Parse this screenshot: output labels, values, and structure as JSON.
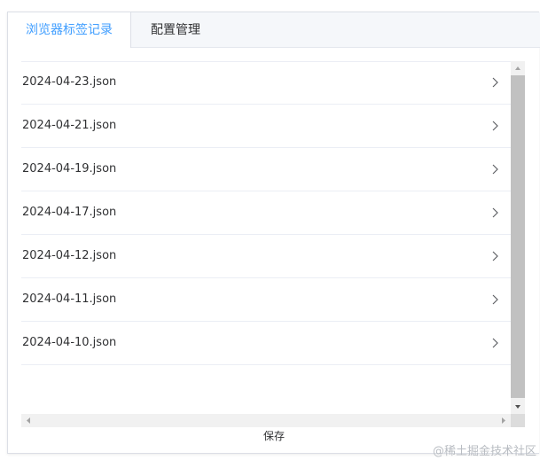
{
  "tabs": [
    {
      "label": "浏览器标签记录",
      "active": true
    },
    {
      "label": "配置管理",
      "active": false
    }
  ],
  "files": [
    "2024-04-23.json",
    "2024-04-21.json",
    "2024-04-19.json",
    "2024-04-17.json",
    "2024-04-12.json",
    "2024-04-11.json",
    "2024-04-10.json"
  ],
  "save_label": "保存",
  "watermark": "@稀土掘金技术社区",
  "colors": {
    "accent": "#409eff",
    "text": "#303133",
    "border": "#ebeef5"
  }
}
